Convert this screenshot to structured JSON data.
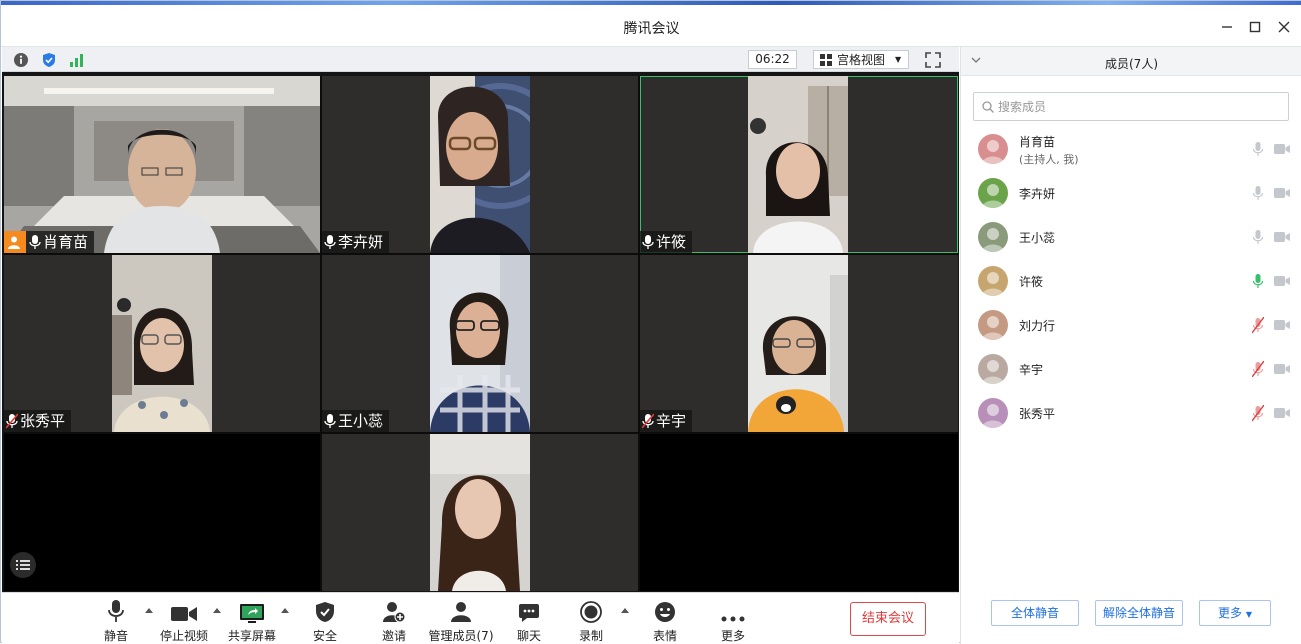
{
  "window": {
    "title": "腾讯会议"
  },
  "topstrip": {
    "timer": "06:22",
    "view_label": "宫格视图"
  },
  "tiles": [
    {
      "name": "肖育苗",
      "mic": "on",
      "host": true
    },
    {
      "name": "李卉妍",
      "mic": "on"
    },
    {
      "name": "许筱",
      "mic": "on",
      "speaking": true
    },
    {
      "name": "张秀平",
      "mic": "muted"
    },
    {
      "name": "王小蕊",
      "mic": "on"
    },
    {
      "name": "辛宇",
      "mic": "muted"
    },
    {
      "name": "",
      "mic": "none"
    },
    {
      "name": "",
      "mic": "none"
    },
    {
      "name": "",
      "mic": "none"
    }
  ],
  "toolbar": {
    "mute": "静音",
    "stop_video": "停止视频",
    "share": "共享屏幕",
    "security": "安全",
    "invite": "邀请",
    "manage": "管理成员(7)",
    "chat": "聊天",
    "record": "录制",
    "emoji": "表情",
    "more": "更多",
    "end": "结束会议"
  },
  "panel": {
    "title": "成员(7人)",
    "search_placeholder": "搜索成员",
    "members": [
      {
        "name": "肖育苗",
        "sub": "(主持人, 我)",
        "mic": "idle"
      },
      {
        "name": "李卉妍",
        "mic": "idle"
      },
      {
        "name": "王小蕊",
        "mic": "idle"
      },
      {
        "name": "许筱",
        "mic": "speaking"
      },
      {
        "name": "刘力行",
        "mic": "muted"
      },
      {
        "name": "辛宇",
        "mic": "muted"
      },
      {
        "name": "张秀平",
        "mic": "muted"
      }
    ],
    "mute_all": "全体静音",
    "unmute_all": "解除全体静音",
    "more": "更多"
  },
  "colors": {
    "accent": "#1f6fe0",
    "end_red": "#e03a3a",
    "speaking_green": "#36c06b",
    "host_orange": "#f58a1f"
  },
  "icons": [
    "info-icon",
    "shield-icon",
    "signal-icon",
    "fullscreen-icon",
    "mic-icon",
    "mic-muted-icon",
    "camera-icon",
    "search-icon",
    "chevron-down-icon",
    "minimize-icon",
    "maximize-icon",
    "close-icon"
  ]
}
